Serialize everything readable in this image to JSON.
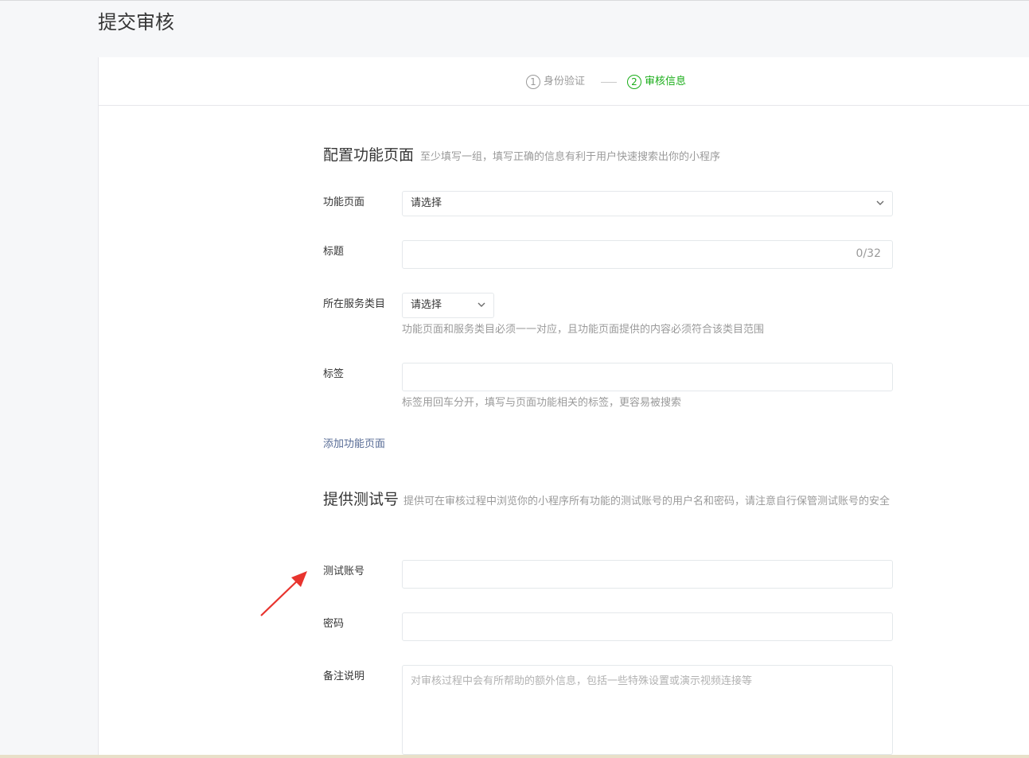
{
  "page": {
    "title": "提交审核"
  },
  "steps": [
    {
      "num": "1",
      "label": "身份验证"
    },
    {
      "num": "2",
      "label": "审核信息"
    }
  ],
  "config_section": {
    "title": "配置功能页面",
    "desc": "至少填写一组，填写正确的信息有利于用户快速搜索出你的小程序"
  },
  "fields": {
    "function_page": {
      "label": "功能页面",
      "value": "请选择"
    },
    "title": {
      "label": "标题",
      "counter": "0/32"
    },
    "category": {
      "label": "所在服务类目",
      "value": "请选择",
      "hint": "功能页面和服务类目必须一一对应，且功能页面提供的内容必须符合该类目范围"
    },
    "tags": {
      "label": "标签",
      "hint": "标签用回车分开，填写与页面功能相关的标签，更容易被搜索"
    }
  },
  "add_link": "添加功能页面",
  "test_section": {
    "title": "提供测试号",
    "desc": "提供可在审核过程中浏览你的小程序所有功能的测试账号的用户名和密码，请注意自行保管测试账号的安全"
  },
  "test_fields": {
    "account": {
      "label": "测试账号"
    },
    "password": {
      "label": "密码"
    },
    "remark": {
      "label": "备注说明",
      "placeholder": "对审核过程中会有所帮助的额外信息，包括一些特殊设置或演示视频连接等"
    }
  },
  "colors": {
    "accent": "#1aad19",
    "link": "#576b95",
    "annotation_arrow": "#e8342e"
  }
}
